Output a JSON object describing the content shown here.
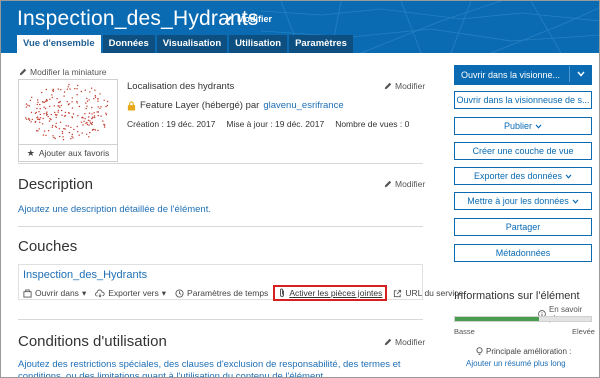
{
  "header": {
    "title": "Inspection_des_Hydrants",
    "edit_label": "Modifier",
    "tabs": [
      {
        "label": "Vue d'ensemble",
        "active": true
      },
      {
        "label": "Données",
        "active": false
      },
      {
        "label": "Visualisation",
        "active": false
      },
      {
        "label": "Utilisation",
        "active": false
      },
      {
        "label": "Paramètres",
        "active": false
      }
    ],
    "colors": {
      "banner": "#0a6bb3",
      "tab_dark": "#0c4f80"
    }
  },
  "thumbnail": {
    "edit_label": "Modifier la miniature",
    "favorite_label": "Ajouter aux favoris"
  },
  "item_info": {
    "summary": "Localisation des hydrants",
    "edit_label": "Modifier",
    "type_text": "Feature Layer (hébergé) par",
    "owner": "glavenu_esrifrance",
    "created": "Création : 19 déc. 2017",
    "updated": "Mise à jour : 19 déc. 2017",
    "views": "Nombre de vues : 0"
  },
  "description": {
    "heading": "Description",
    "edit_label": "Modifier",
    "text": "Ajoutez une description détaillée de l'élément."
  },
  "layers": {
    "heading": "Couches",
    "layer_name": "Inspection_des_Hydrants",
    "actions": {
      "open_in": "Ouvrir dans",
      "export_to": "Exporter vers",
      "time_settings": "Paramètres de temps",
      "enable_attachments": "Activer les pièces jointes",
      "service_url": "URL du service"
    },
    "highlight_color": "#d62020"
  },
  "terms": {
    "heading": "Conditions d'utilisation",
    "edit_label": "Modifier",
    "text": "Ajoutez des restrictions spéciales, des clauses d'exclusion de responsabilité, des termes et conditions, ou des limitations quant à l'utilisation du contenu de l'élément."
  },
  "sidebar": {
    "open_map_viewer": "Ouvrir dans la visionne...",
    "open_scene_viewer": "Ouvrir dans la visionneuse de s...",
    "publish": "Publier",
    "create_view_layer": "Créer une couche de vue",
    "export_data": "Exporter des données",
    "update_data": "Mettre à jour les données",
    "share": "Partager",
    "metadata": "Métadonnées"
  },
  "item_information": {
    "heading": "Informations sur l'élément",
    "learn_more": "En savoir plus",
    "level": 0.62,
    "low_label": "Basse",
    "high_label": "Elevée",
    "improvement_label": "Principale amélioration :",
    "improvement_link": "Ajouter un résumé plus long",
    "meter_color": "#4a9d4f"
  }
}
